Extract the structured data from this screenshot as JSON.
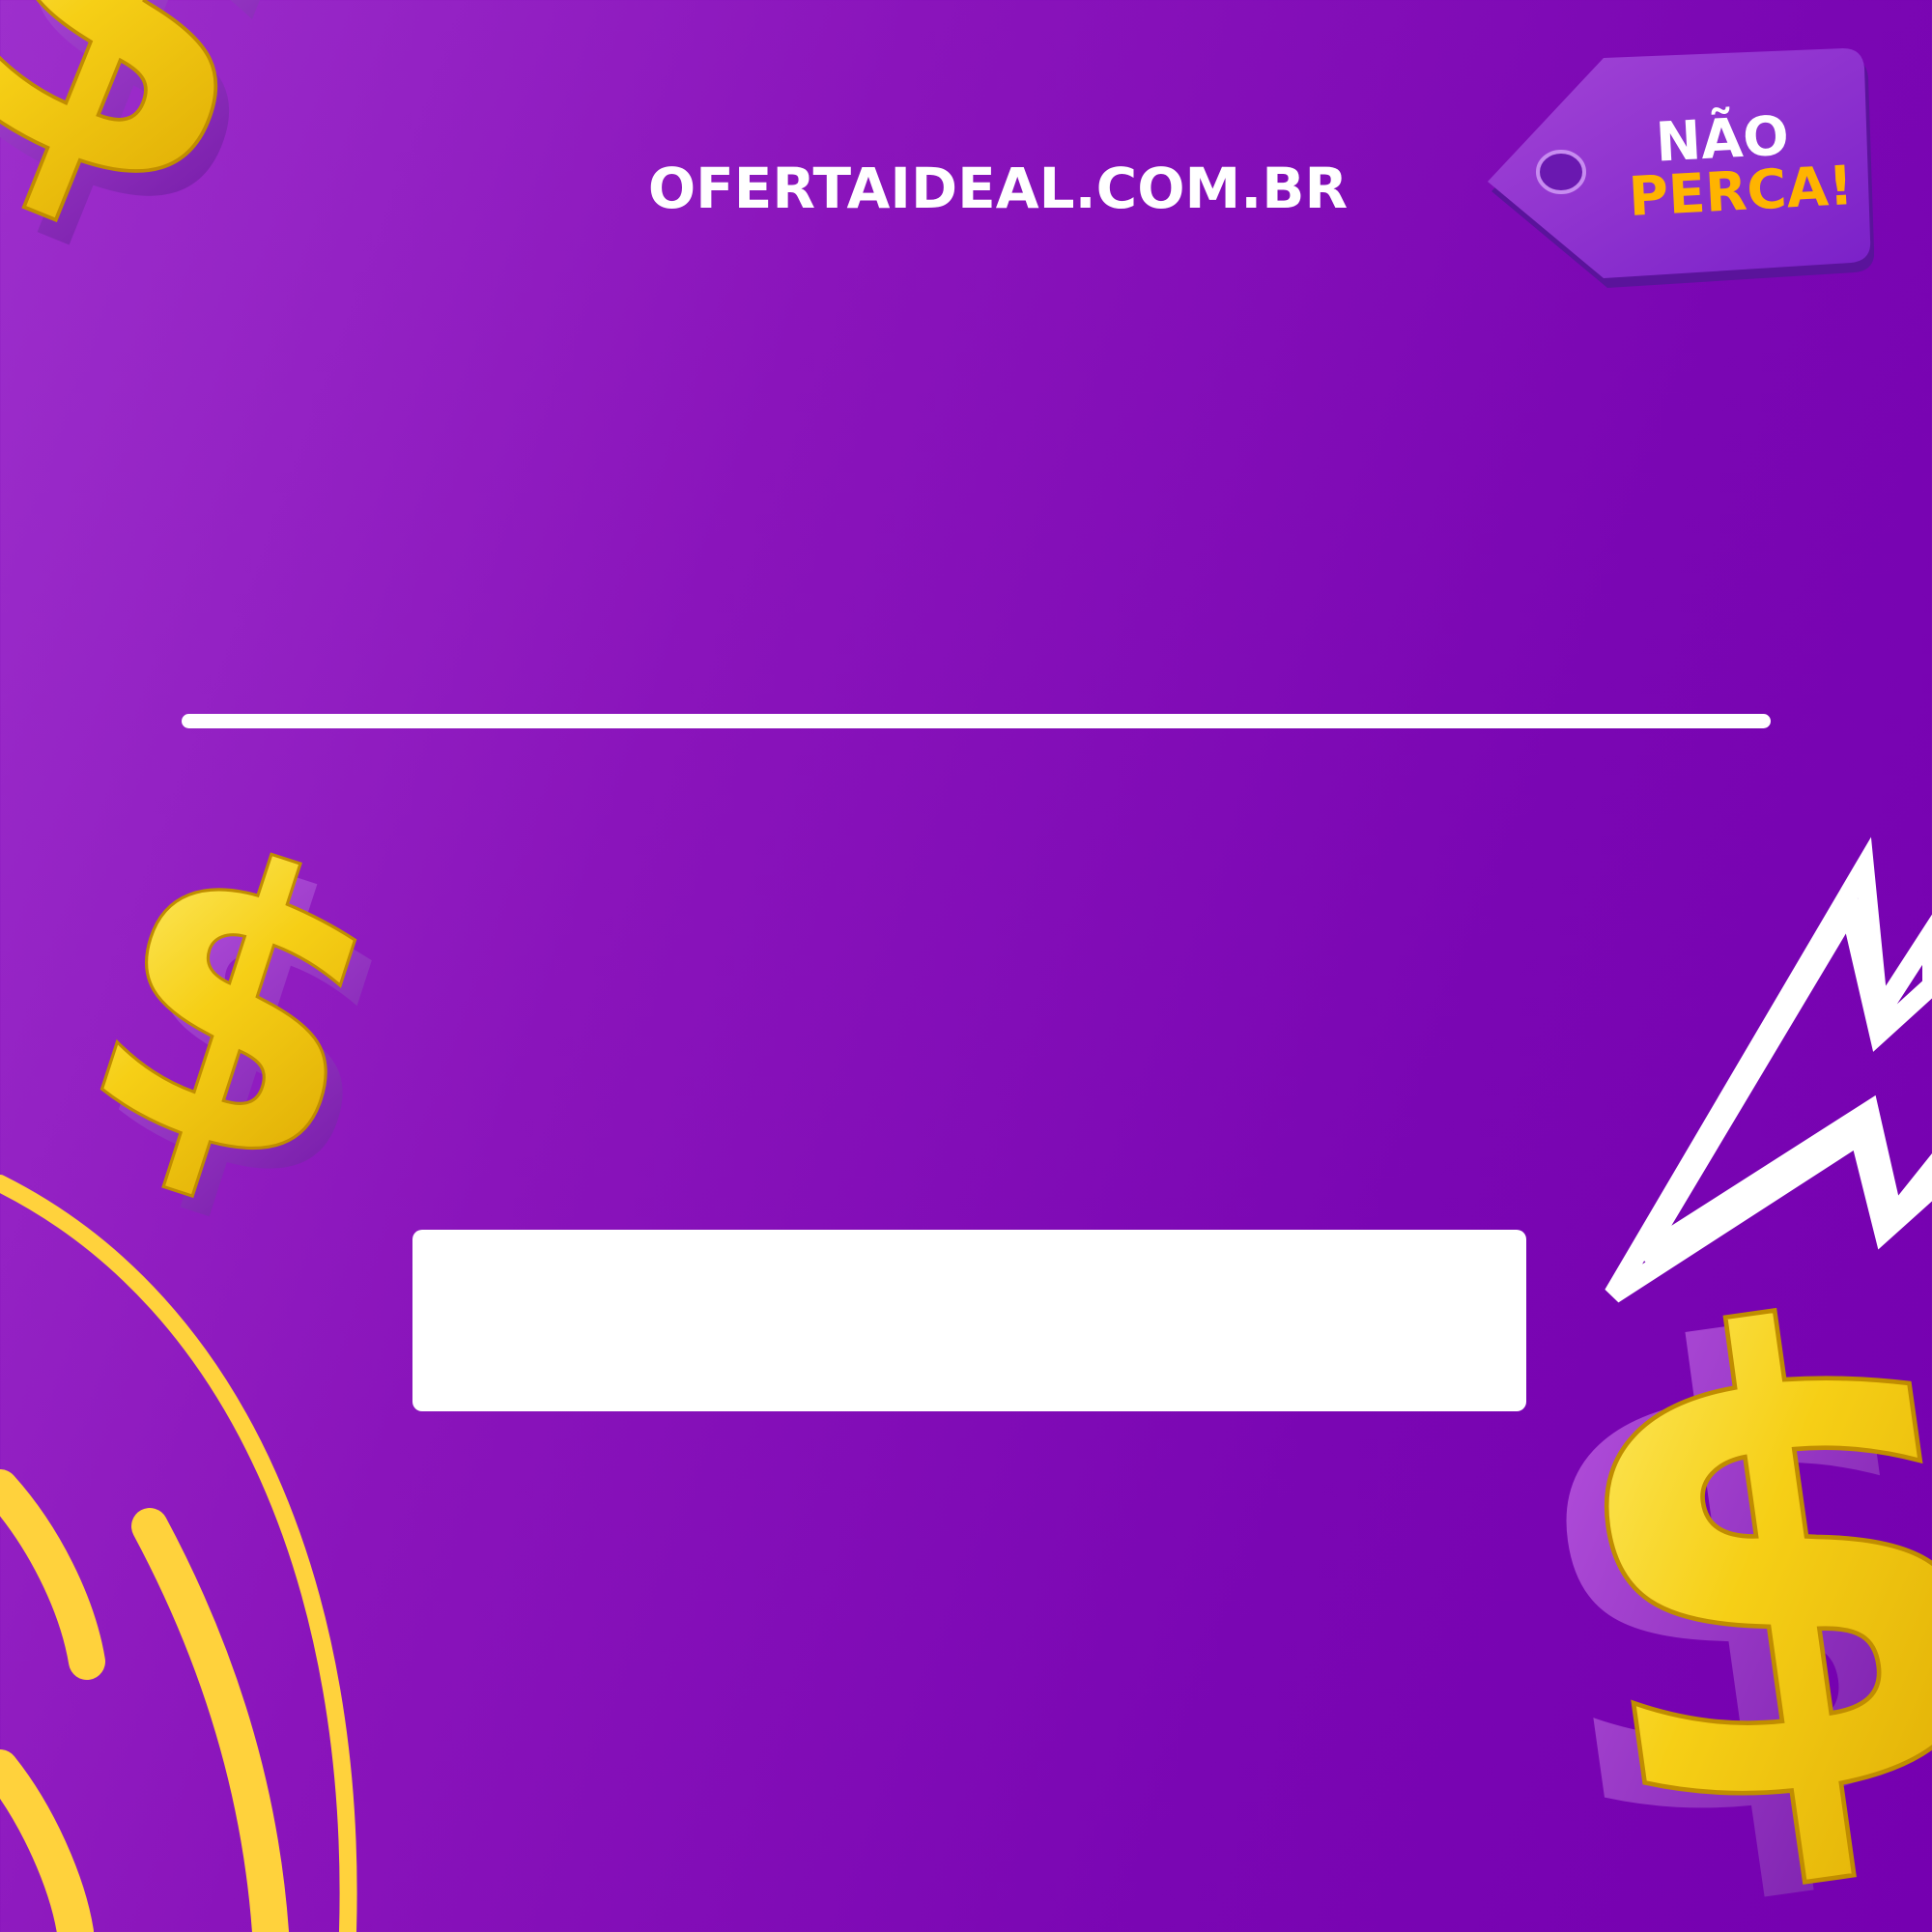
{
  "site": {
    "url": "OFERTAIDEAL.COM.BR"
  },
  "tag": {
    "line1": "NÃO",
    "line2": "PERCA!"
  },
  "decorations": {
    "dollar_icons": [
      "dollar-icon",
      "dollar-icon",
      "dollar-icon"
    ],
    "lightning_outline": "lightning-icon",
    "yellow_arcs": "arc-lines"
  },
  "colors": {
    "background": "#8a14bb",
    "accent_yellow": "#ffd23c",
    "gold": "#f2c200",
    "tag_purple": "#8a3ad4",
    "tag_text_orange": "#ffb400",
    "white": "#ffffff"
  }
}
